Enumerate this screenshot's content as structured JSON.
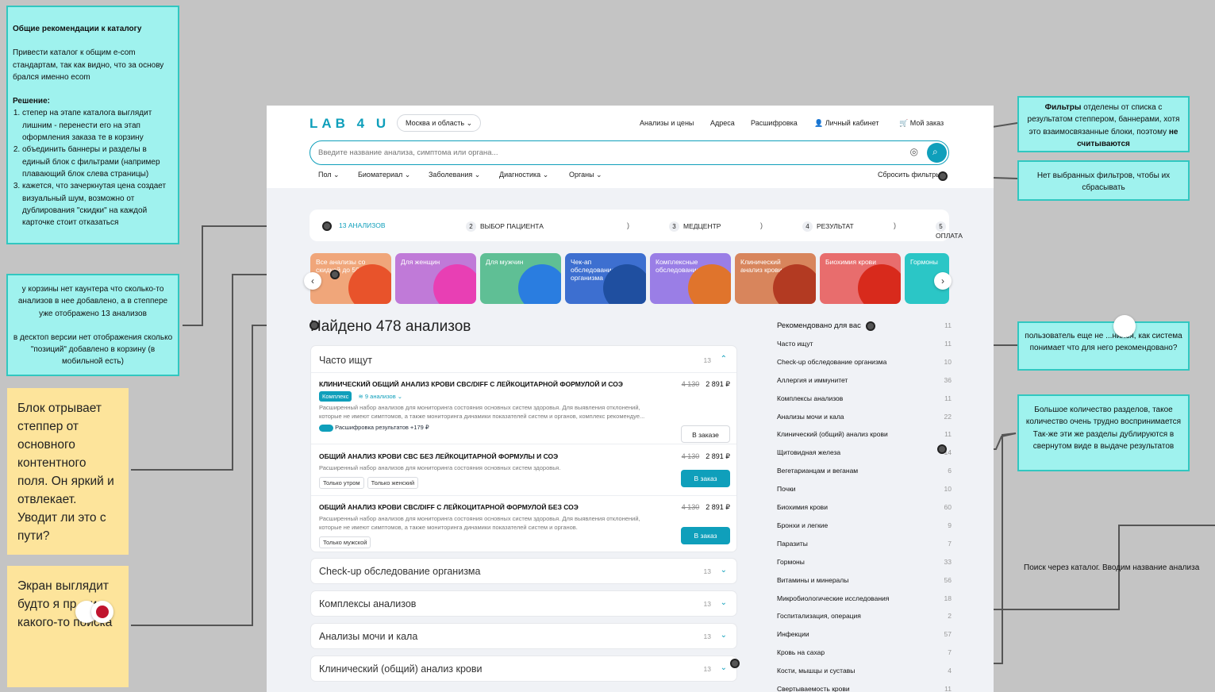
{
  "notes": {
    "catalog_title": "Общие рекомендации к каталогу",
    "catalog_p1": "Привести каталог к общим e-com стандартам, так как видно, что за основу брался именно ecom",
    "catalog_solution": "Решение:",
    "catalog_list": [
      "степер на этапе каталога выглядит лишним - перенести его на этап оформления заказа те в корзину",
      "объединить баннеры и разделы в единый блок с фильтрами (например плавающий блок слева страницы)",
      "кажется, что зачеркнутая цена создает визуальный шум, возможно от дублирования \"скидки\" на каждой карточке стоит отказаться"
    ],
    "cart_p1": "у корзины нет каунтера что сколько-то анализов в нее добавлено, а в степпере уже отображено 13 анализов",
    "cart_p2": "в десктоп версии нет отображения сколько \"позиций\" добавлено в корзину (в мобильной есть)",
    "yellow1": "Блок отрывает степпер от основного контентного поля. Он яркий и отвлекает. Уводит ли это с пути?",
    "yellow2": "Экран выглядит будто я пр... из какого-то поиска",
    "filters_bold": "Фильтры",
    "filters_text": " отделены от списка с результатом степпером, баннерами, хотя это взаимосвязанные блоки, поэтому ",
    "filters_bold2": "не считываются",
    "no_filters": "Нет выбранных фильтров, чтобы их сбрасывать",
    "recommended": "пользователь еще не ...нился, как система понимает что для него рекомендовано?",
    "sections": "Большое количество разделов, такое количество очень трудно воспринимается Так-же эти же разделы дублируются в свернутом виде в выдаче результатов",
    "search_catalog": "Поиск через каталог. Вводим название анализа"
  },
  "header": {
    "logo": "LAB 4 U",
    "city": "Москва и область",
    "nav": [
      "Анализы и цены",
      "Адреса",
      "Расшифровка",
      "Личный кабинет",
      "Мой заказ"
    ],
    "search_placeholder": "Введите название анализа, симптома или органа...",
    "filters": [
      "Пол",
      "Биоматериал",
      "Заболевания",
      "Диагностика",
      "Органы"
    ],
    "reset": "Сбросить фильтры"
  },
  "stepper": [
    {
      "num": "",
      "label": "13 анализов"
    },
    {
      "num": "2",
      "label": "Выбор пациента"
    },
    {
      "num": "3",
      "label": "Медцентр"
    },
    {
      "num": "4",
      "label": "Результат"
    },
    {
      "num": "5",
      "label": "Оплата"
    }
  ],
  "banners": [
    {
      "label": "Все анализы со скидкой до 50%",
      "color": "#f0a67a"
    },
    {
      "label": "Для женщин",
      "color": "#c07ad8"
    },
    {
      "label": "Для мужчин",
      "color": "#5fbf95"
    },
    {
      "label": "Чек-ап обследование организма",
      "color": "#3d6fd0"
    },
    {
      "label": "Комплексные обследования",
      "color": "#9a7ee6"
    },
    {
      "label": "Клинический анализ крови",
      "color": "#d8855c"
    },
    {
      "label": "Биохимия крови",
      "color": "#e86d6d"
    },
    {
      "label": "Гормоны",
      "color": "#2bc6c6"
    }
  ],
  "found": "Найдено 478 анализов",
  "often": {
    "title": "Часто ищут",
    "count": "13",
    "items": [
      {
        "title": "Клинический общий анализ крови CBC/DIFF с лейкоцитарной формулой и СОЭ",
        "old": "4 130",
        "price": "2 891 ₽",
        "desc": "Расширенный набор анализов для мониторинга состояния основных систем здоровья. Для выявления отклонений, которые не имеют симптомов, а также мониторинга динамики показателей систем и органов, комплекс рекомендуе...",
        "badge": "Комплекс",
        "sub": "9 анализов",
        "toggle": "Расшифровка результатов +179 ₽",
        "button": "В заказе"
      },
      {
        "title": "Общий анализ крови CBC без лейкоцитарной формулы  и СОЭ",
        "old": "4 130",
        "price": "2 891 ₽",
        "desc": "Расширенный набор анализов для мониторинга состояния основных систем здоровья.",
        "tags": [
          "Только утром",
          "Только женский"
        ],
        "button": "В заказ"
      },
      {
        "title": "Общий анализ крови CBC/DIFF с лейкоцитарной формулой без СОЭ",
        "old": "4 130",
        "price": "2 891 ₽",
        "desc": "Расширенный набор анализов для мониторинга состояния основных систем здоровья. Для выявления отклонений, которые не имеют симптомов, а также мониторинга динамики показателей систем и органов.",
        "tags": [
          "Только мужской"
        ],
        "button": "В заказ"
      }
    ]
  },
  "collapsed": [
    {
      "title": "Check-up обследование организма",
      "count": "13"
    },
    {
      "title": "Комплексы анализов",
      "count": "13"
    },
    {
      "title": "Анализы мочи и кала",
      "count": "13"
    },
    {
      "title": "Клинический (общий) анализ крови",
      "count": "13"
    }
  ],
  "sidebar": [
    {
      "label": "Рекомендовано для вас",
      "n": "11"
    },
    {
      "label": "Часто ищут",
      "n": "11"
    },
    {
      "label": "Check-up обследование организма",
      "n": "10"
    },
    {
      "label": "Аллергия и иммунитет",
      "n": "36"
    },
    {
      "label": "Комплексы анализов",
      "n": "11"
    },
    {
      "label": "Анализы мочи и кала",
      "n": "22"
    },
    {
      "label": "Клинический (общий) анализ крови",
      "n": "11"
    },
    {
      "label": "Щитовидная железа",
      "n": "14"
    },
    {
      "label": "Вегетарианцам и веганам",
      "n": "6"
    },
    {
      "label": "Почки",
      "n": "10"
    },
    {
      "label": "Биохимия крови",
      "n": "60"
    },
    {
      "label": "Бронхи и легкие",
      "n": "9"
    },
    {
      "label": "Паразиты",
      "n": "7"
    },
    {
      "label": "Гормоны",
      "n": "33"
    },
    {
      "label": "Витамины и минералы",
      "n": "56"
    },
    {
      "label": "Микробиологические исследования",
      "n": "18"
    },
    {
      "label": "Госпитализация, операция",
      "n": "2"
    },
    {
      "label": "Инфекции",
      "n": "57"
    },
    {
      "label": "Кровь на сахар",
      "n": "7"
    },
    {
      "label": "Кости, мышцы и суставы",
      "n": "4"
    },
    {
      "label": "Свертываемость крови",
      "n": "11"
    }
  ],
  "colors": {
    "accent": "#0f9fbb",
    "note_bg": "#9ff2ee",
    "note_border": "#31c7c0",
    "sticky": "#fde49b"
  }
}
